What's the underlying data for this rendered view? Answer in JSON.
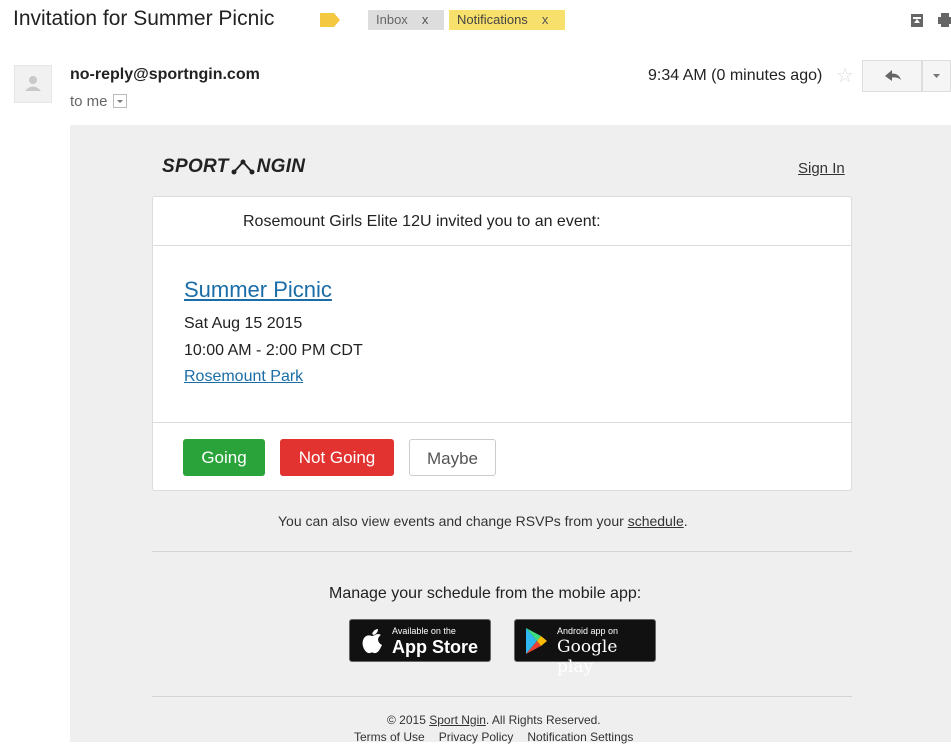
{
  "subject": "Invitation for Summer Picnic",
  "labels": [
    {
      "name": "Inbox",
      "remove": "x"
    },
    {
      "name": "Notifications",
      "remove": "x"
    }
  ],
  "colors": {
    "label_tag": "#f5c842",
    "notifications_chip": "#f7e06b",
    "going": "#2aa33a",
    "not_going": "#e23330",
    "link": "#1a6da7"
  },
  "message": {
    "sender": "no-reply@sportngin.com",
    "recipient": "to me",
    "time": "9:34 AM (0 minutes ago)"
  },
  "email": {
    "logo_left": "SPORT",
    "logo_right": "NGIN",
    "sign_in": "Sign In",
    "invite_text": "Rosemount Girls Elite 12U invited you to an event:",
    "event": {
      "title": "Summer Picnic",
      "date": "Sat Aug 15 2015",
      "time": "10:00 AM - 2:00 PM CDT",
      "location": "Rosemount Park"
    },
    "rsvp": {
      "going": "Going",
      "not_going": "Not Going",
      "maybe": "Maybe"
    },
    "rsvp_note_prefix": "You can also view events and change RSVPs from your ",
    "rsvp_note_link": "schedule",
    "rsvp_note_suffix": ".",
    "manage_text": "Manage your schedule from the mobile app:",
    "app_store": {
      "small": "Available on the",
      "big": "App Store"
    },
    "google_play": {
      "small": "Android app on",
      "big": "Google play"
    },
    "footer": {
      "copyright_prefix": "© 2015 ",
      "copyright_link": "Sport Ngin",
      "copyright_suffix": ". All Rights Reserved.",
      "links": [
        "Terms of Use",
        "Privacy Policy",
        "Notification Settings"
      ]
    }
  },
  "icons": [
    "label-tag-icon",
    "avatar-icon",
    "star-icon",
    "reply-icon",
    "chevron-down-icon",
    "archive-icon",
    "print-icon",
    "apple-icon",
    "play-icon"
  ]
}
